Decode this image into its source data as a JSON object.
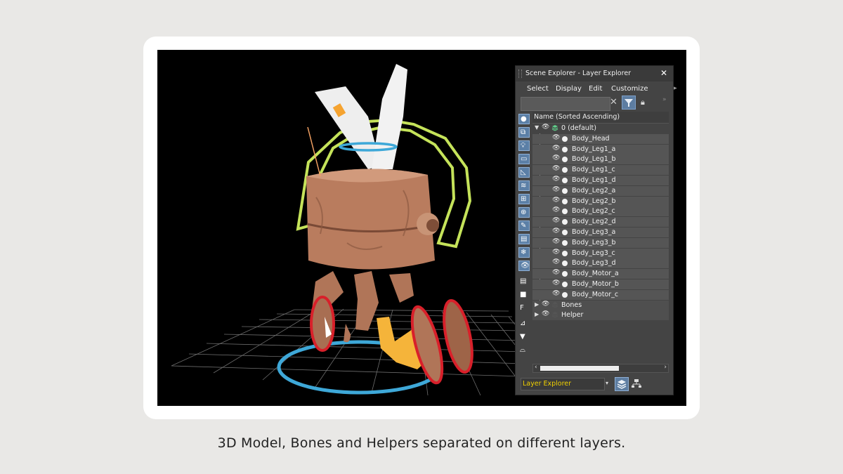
{
  "panel": {
    "title": "Scene Explorer - Layer Explorer",
    "menu": [
      "Select",
      "Display",
      "Edit",
      "Customize"
    ],
    "search": {
      "value": "",
      "placeholder": ""
    },
    "column_header": "Name (Sorted Ascending)",
    "tree": [
      {
        "label": "0 (default)",
        "level": 0,
        "expanded": true,
        "type": "layer"
      },
      {
        "label": "Body_Head",
        "level": 1,
        "type": "object"
      },
      {
        "label": "Body_Leg1_a",
        "level": 1,
        "type": "object"
      },
      {
        "label": "Body_Leg1_b",
        "level": 1,
        "type": "object"
      },
      {
        "label": "Body_Leg1_c",
        "level": 1,
        "type": "object"
      },
      {
        "label": "Body_Leg1_d",
        "level": 1,
        "type": "object"
      },
      {
        "label": "Body_Leg2_a",
        "level": 1,
        "type": "object"
      },
      {
        "label": "Body_Leg2_b",
        "level": 1,
        "type": "object"
      },
      {
        "label": "Body_Leg2_c",
        "level": 1,
        "type": "object"
      },
      {
        "label": "Body_Leg2_d",
        "level": 1,
        "type": "object"
      },
      {
        "label": "Body_Leg3_a",
        "level": 1,
        "type": "object"
      },
      {
        "label": "Body_Leg3_b",
        "level": 1,
        "type": "object"
      },
      {
        "label": "Body_Leg3_c",
        "level": 1,
        "type": "object"
      },
      {
        "label": "Body_Leg3_d",
        "level": 1,
        "type": "object"
      },
      {
        "label": "Body_Motor_a",
        "level": 1,
        "type": "object"
      },
      {
        "label": "Body_Motor_b",
        "level": 1,
        "type": "object"
      },
      {
        "label": "Body_Motor_c",
        "level": 1,
        "type": "object"
      },
      {
        "label": "Bones",
        "level": 0,
        "expanded": false,
        "type": "layer"
      },
      {
        "label": "Helper",
        "level": 0,
        "expanded": false,
        "type": "layer"
      }
    ],
    "footer_dropdown": "Layer Explorer",
    "side_tools": [
      "sphere-icon",
      "shapes-icon",
      "light-icon",
      "camera-icon",
      "helper-icon",
      "spacewarp-icon",
      "group-icon",
      "xref-icon",
      "bone-icon",
      "container-icon",
      "frozen-icon",
      "hidden-icon",
      "doc-icon",
      "select-all-icon",
      "doc-f-icon",
      "filter-toggle-icon",
      "funnel-icon",
      "selection-set-icon"
    ]
  },
  "caption": "3D Model, Bones and Helpers separated on different layers.",
  "colors": {
    "background": "#e9e8e6",
    "panel": "#444444",
    "selection_blue": "#5d7da1",
    "footer_text": "#f0d000",
    "gizmo_green": "#c5e35a",
    "gizmo_blue": "#3ea8d8",
    "gizmo_red": "#d8202a",
    "gizmo_orange": "#f5b43a"
  }
}
